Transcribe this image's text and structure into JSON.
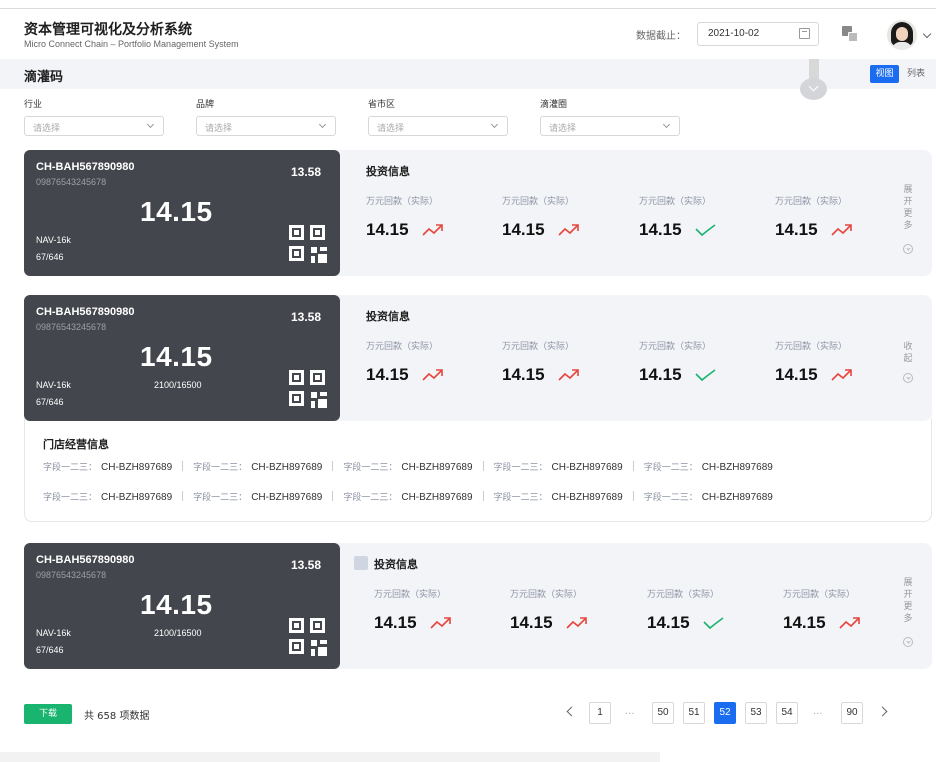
{
  "header": {
    "title": "资本管理可视化及分析系统",
    "subtitle": "Micro Connect Chain – Portfolio Management System",
    "date_label": "数据截止：",
    "date_value": "2021-10-02"
  },
  "subbar": {
    "section_title": "滴灌码",
    "view_label": "视图",
    "list_label": "列表"
  },
  "filters": [
    {
      "label": "行业",
      "placeholder": "请选择"
    },
    {
      "label": "品牌",
      "placeholder": "请选择"
    },
    {
      "label": "省市区",
      "placeholder": "请选择"
    },
    {
      "label": "滴灌圈",
      "placeholder": "请选择"
    }
  ],
  "cards": [
    {
      "code": "CH-BAH567890980",
      "serial": "09876543245678",
      "right_num": "13.58",
      "big_num": "14.15",
      "nav": "NAV-16k",
      "frac": "67/646",
      "mid": "",
      "invest_title": "投资信息",
      "metrics": [
        {
          "label": "万元回款（实际）",
          "value": "14.15",
          "trend": "up"
        },
        {
          "label": "万元回款（实际）",
          "value": "14.15",
          "trend": "up"
        },
        {
          "label": "万元回款（实际）",
          "value": "14.15",
          "trend": "down"
        },
        {
          "label": "万元回款（实际）",
          "value": "14.15",
          "trend": "up"
        }
      ],
      "expand_label": "展开更多"
    },
    {
      "code": "CH-BAH567890980",
      "serial": "09876543245678",
      "right_num": "13.58",
      "big_num": "14.15",
      "nav": "NAV-16k",
      "frac": "67/646",
      "mid": "2100/16500",
      "invest_title": "投资信息",
      "metrics": [
        {
          "label": "万元回款（实际）",
          "value": "14.15",
          "trend": "up"
        },
        {
          "label": "万元回款（实际）",
          "value": "14.15",
          "trend": "up"
        },
        {
          "label": "万元回款（实际）",
          "value": "14.15",
          "trend": "down"
        },
        {
          "label": "万元回款（实际）",
          "value": "14.15",
          "trend": "up"
        }
      ],
      "expand_label": "收起"
    },
    {
      "code": "CH-BAH567890980",
      "serial": "09876543245678",
      "right_num": "13.58",
      "big_num": "14.15",
      "nav": "NAV-16k",
      "frac": "67/646",
      "mid": "2100/16500",
      "invest_title": "投资信息",
      "metrics": [
        {
          "label": "万元回款（实际）",
          "value": "14.15",
          "trend": "up"
        },
        {
          "label": "万元回款（实际）",
          "value": "14.15",
          "trend": "up"
        },
        {
          "label": "万元回款（实际）",
          "value": "14.15",
          "trend": "down"
        },
        {
          "label": "万元回款（实际）",
          "value": "14.15",
          "trend": "up"
        }
      ],
      "expand_label": "展开更多"
    }
  ],
  "store": {
    "title": "门店经营信息",
    "rows": [
      [
        {
          "k": "字段一二三：",
          "v": "CH-BZH897689"
        },
        {
          "k": "字段一二三：",
          "v": "CH-BZH897689"
        },
        {
          "k": "字段一二三：",
          "v": "CH-BZH897689"
        },
        {
          "k": "字段一二三：",
          "v": "CH-BZH897689"
        },
        {
          "k": "字段一二三：",
          "v": "CH-BZH897689"
        }
      ],
      [
        {
          "k": "字段一二三：",
          "v": "CH-BZH897689"
        },
        {
          "k": "字段一二三：",
          "v": "CH-BZH897689"
        },
        {
          "k": "字段一二三：",
          "v": "CH-BZH897689"
        },
        {
          "k": "字段一二三：",
          "v": "CH-BZH897689"
        },
        {
          "k": "字段一二三：",
          "v": "CH-BZH897689"
        }
      ]
    ]
  },
  "footer": {
    "download_label": "下载",
    "total_text": "共 658 项数据",
    "pages": [
      "1",
      "...",
      "50",
      "51",
      "52",
      "53",
      "54",
      "...",
      "90"
    ],
    "current_page": "52"
  },
  "colors": {
    "accent": "#1a6cf0",
    "up": "#e8453c",
    "down": "#19b46f",
    "dark_card": "#44464d",
    "download": "#19b46f"
  }
}
